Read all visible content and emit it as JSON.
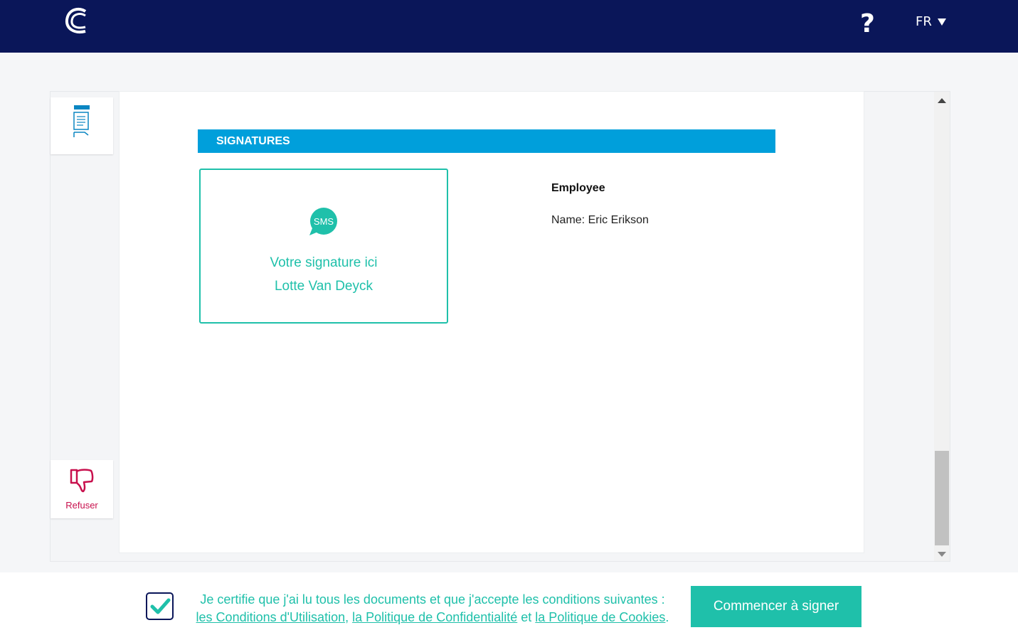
{
  "header": {
    "help_label": "?",
    "language": "FR"
  },
  "document": {
    "section_title": "SIGNATURES",
    "signature_box": {
      "prompt": "Votre signature ici",
      "signer_name": "Lotte Van Deyck",
      "method_icon_label": "SMS"
    },
    "employee": {
      "title": "Employee",
      "name_line": "Name: Eric Erikson"
    }
  },
  "sidebar": {
    "refuse_label": "Refuser"
  },
  "footer": {
    "certify_text": "Je certifie que j'ai lu tous les documents et que j'accepte les conditions suivantes :",
    "terms_link": "les Conditions d'Utilisation",
    "sep_comma": ",",
    "privacy_link": "la Politique de Confidentialité",
    "conj": " et ",
    "cookies_link": "la Politique de Cookies",
    "end_period": ".",
    "start_button": "Commencer à signer",
    "checkbox_checked": true
  },
  "colors": {
    "navbar": "#0a1659",
    "accent_teal": "#1fc0aa",
    "section_blue": "#009fdb",
    "refuse_red": "#c8104d"
  }
}
